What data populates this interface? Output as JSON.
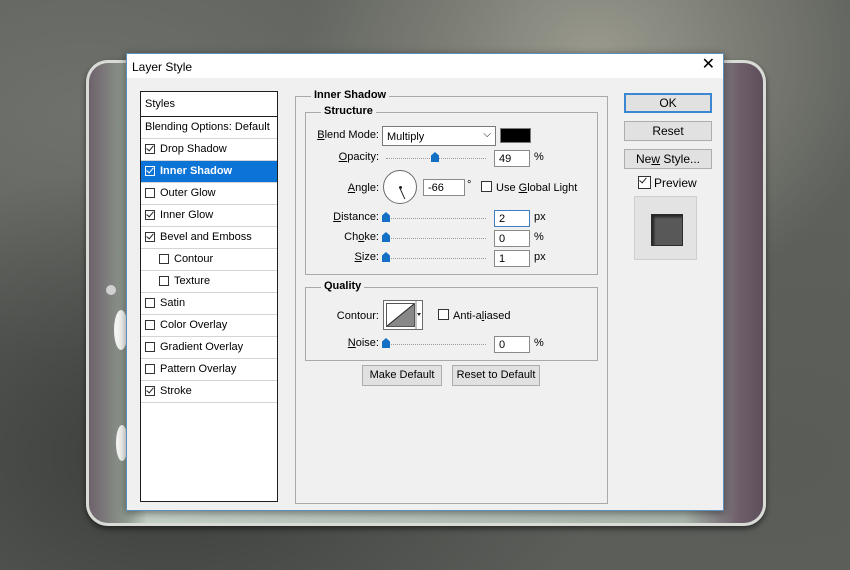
{
  "window": {
    "title": "Layer Style",
    "close_glyph": "✕"
  },
  "left_panel": {
    "header": "Styles",
    "items": [
      {
        "label": "Blending Options: Default",
        "has_checkbox": false,
        "checked": false,
        "selected": false,
        "indent": false
      },
      {
        "label": "Drop Shadow",
        "has_checkbox": true,
        "checked": true,
        "selected": false,
        "indent": false
      },
      {
        "label": "Inner Shadow",
        "has_checkbox": true,
        "checked": true,
        "selected": true,
        "indent": false
      },
      {
        "label": "Outer Glow",
        "has_checkbox": true,
        "checked": false,
        "selected": false,
        "indent": false
      },
      {
        "label": "Inner Glow",
        "has_checkbox": true,
        "checked": true,
        "selected": false,
        "indent": false
      },
      {
        "label": "Bevel and Emboss",
        "has_checkbox": true,
        "checked": true,
        "selected": false,
        "indent": false
      },
      {
        "label": "Contour",
        "has_checkbox": true,
        "checked": false,
        "selected": false,
        "indent": true
      },
      {
        "label": "Texture",
        "has_checkbox": true,
        "checked": false,
        "selected": false,
        "indent": true
      },
      {
        "label": "Satin",
        "has_checkbox": true,
        "checked": false,
        "selected": false,
        "indent": false
      },
      {
        "label": "Color Overlay",
        "has_checkbox": true,
        "checked": false,
        "selected": false,
        "indent": false
      },
      {
        "label": "Gradient Overlay",
        "has_checkbox": true,
        "checked": false,
        "selected": false,
        "indent": false
      },
      {
        "label": "Pattern Overlay",
        "has_checkbox": true,
        "checked": false,
        "selected": false,
        "indent": false
      },
      {
        "label": "Stroke",
        "has_checkbox": true,
        "checked": true,
        "selected": false,
        "indent": false
      }
    ]
  },
  "inner_shadow": {
    "title": "Inner Shadow",
    "structure": {
      "title": "Structure",
      "blend_mode": {
        "label_pre": "",
        "label_u": "B",
        "label_post": "lend Mode:",
        "value": "Multiply",
        "color": "#000000"
      },
      "opacity": {
        "label_u": "O",
        "label_post": "pacity:",
        "value": "49",
        "unit": "%",
        "level": 0.49
      },
      "angle": {
        "label_u": "A",
        "label_post": "ngle:",
        "value": "-66",
        "unit": "°",
        "global_light_label_pre": "Use ",
        "global_light_label_u": "G",
        "global_light_label_post": "lobal Light",
        "global_light_checked": false
      },
      "distance": {
        "label_u": "D",
        "label_post": "istance:",
        "value": "2",
        "unit": "px",
        "level": 0.0
      },
      "choke": {
        "label_pre": "Ch",
        "label_u": "o",
        "label_post": "ke:",
        "value": "0",
        "unit": "%",
        "level": 0.0
      },
      "size": {
        "label_u": "S",
        "label_post": "ize:",
        "value": "1",
        "unit": "px",
        "level": 0.0
      }
    },
    "quality": {
      "title": "Quality",
      "contour_label": "Contour:",
      "anti_aliased_label_pre": "Anti-a",
      "anti_aliased_label_u": "l",
      "anti_aliased_label_post": "iased",
      "anti_aliased_checked": false,
      "noise": {
        "label_u": "N",
        "label_post": "oise:",
        "value": "0",
        "unit": "%",
        "level": 0.0
      }
    },
    "make_default": "Make Default",
    "reset_to_default": "Reset to Default"
  },
  "right_panel": {
    "ok": "OK",
    "reset": "Reset",
    "new_style_pre": "Ne",
    "new_style_u": "w",
    "new_style_post": " Style...",
    "preview_label": "Preview",
    "preview_checked": true
  }
}
